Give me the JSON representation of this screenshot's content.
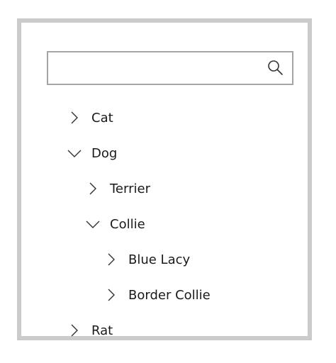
{
  "search": {
    "value": "",
    "placeholder": "",
    "icon": "search-icon"
  },
  "tree": {
    "items": [
      {
        "label": "Cat",
        "expanded": false,
        "icon": "chevron-right-icon"
      },
      {
        "label": "Dog",
        "expanded": true,
        "icon": "chevron-down-icon"
      },
      {
        "label": "Terrier",
        "expanded": false,
        "icon": "chevron-right-icon"
      },
      {
        "label": "Collie",
        "expanded": true,
        "icon": "chevron-down-icon"
      },
      {
        "label": "Blue Lacy",
        "expanded": false,
        "icon": "chevron-right-icon"
      },
      {
        "label": "Border Collie",
        "expanded": false,
        "icon": "chevron-right-icon"
      },
      {
        "label": "Rat",
        "expanded": false,
        "icon": "chevron-right-icon"
      }
    ]
  },
  "colors": {
    "border": "#cbcbcb",
    "search_border": "#a5a5a5",
    "text": "#1a1a1a"
  }
}
